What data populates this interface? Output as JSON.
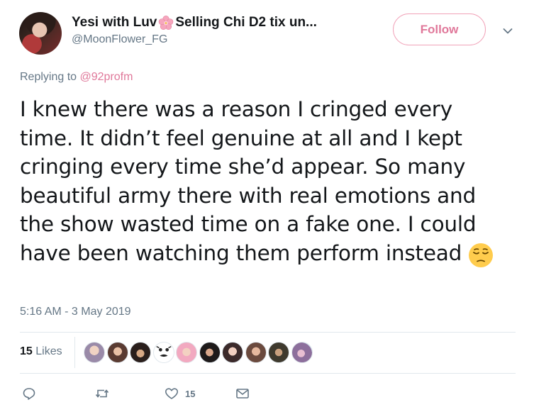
{
  "author": {
    "display_name_before": "Yesi with Luv",
    "display_name_after": "Selling Chi D2 tix un...",
    "name_emoji": "cherry-blossom-icon",
    "handle": "@MoonFlower_FG"
  },
  "follow_button": {
    "label": "Follow"
  },
  "reply": {
    "prefix": "Replying to",
    "mention": "@92profm"
  },
  "tweet": {
    "text": "I knew there was a reason I cringed every time. It didn’t feel genuine at all and I kept cringing every time she’d appear. So many beautiful army there with real emotions and the show wasted time on a fake one. I could have been watching them perform instead",
    "trailing_emoji": "pensive-face-icon"
  },
  "timestamp": "5:16 AM - 3 May 2019",
  "stats": {
    "likes_count": "15",
    "likes_label": "Likes"
  },
  "likers_count": 10,
  "actions": {
    "reply_icon": "reply-icon",
    "retweet_icon": "retweet-icon",
    "like_count": "15",
    "dm_icon": "envelope-icon"
  },
  "colors": {
    "accent": "#e0789a",
    "follow_border": "#f1a2b8",
    "secondary_text": "#657786",
    "divider": "#e1e8ed"
  }
}
